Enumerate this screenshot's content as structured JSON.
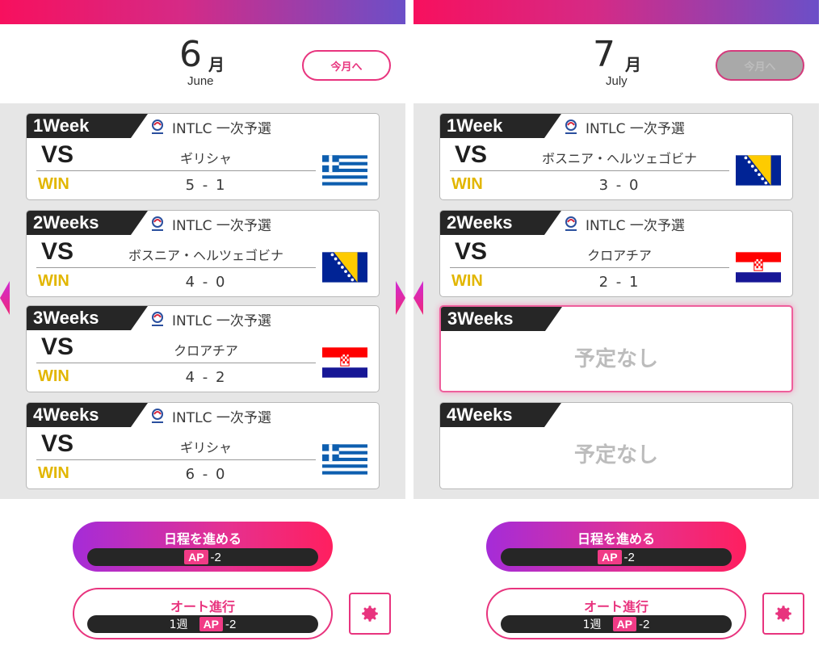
{
  "panels": [
    {
      "month": {
        "number": "6",
        "kanji": "月",
        "english": "June"
      },
      "this_month_button": "今月へ",
      "matches": [
        {
          "week": "1Week",
          "competition": "INTLC 一次予選",
          "vs": "VS",
          "opponent": "ギリシャ",
          "result": "WIN",
          "score": "5 - 1",
          "flag": "greece-flag"
        },
        {
          "week": "2Weeks",
          "competition": "INTLC 一次予選",
          "vs": "VS",
          "opponent": "ボスニア・ヘルツェゴビナ",
          "result": "WIN",
          "score": "4 - 0",
          "flag": "bosnia-flag"
        },
        {
          "week": "3Weeks",
          "competition": "INTLC 一次予選",
          "vs": "VS",
          "opponent": "クロアチア",
          "result": "WIN",
          "score": "4 - 2",
          "flag": "croatia-flag"
        },
        {
          "week": "4Weeks",
          "competition": "INTLC 一次予選",
          "vs": "VS",
          "opponent": "ギリシャ",
          "result": "WIN",
          "score": "6 - 0",
          "flag": "greece-flag"
        }
      ],
      "advance_button": {
        "label": "日程を進める",
        "ap_tag": "AP",
        "ap_value": "-2"
      },
      "auto_button": {
        "label": "オート進行",
        "weeks": "1週",
        "ap_tag": "AP",
        "ap_value": "-2"
      }
    },
    {
      "month": {
        "number": "7",
        "kanji": "月",
        "english": "July"
      },
      "this_month_button": "今月へ",
      "matches": [
        {
          "week": "1Week",
          "competition": "INTLC 一次予選",
          "vs": "VS",
          "opponent": "ボスニア・ヘルツェゴビナ",
          "result": "WIN",
          "score": "3 - 0",
          "flag": "bosnia-flag"
        },
        {
          "week": "2Weeks",
          "competition": "INTLC 一次予選",
          "vs": "VS",
          "opponent": "クロアチア",
          "result": "WIN",
          "score": "2 - 1",
          "flag": "croatia-flag"
        },
        {
          "week": "3Weeks",
          "empty_text": "予定なし"
        },
        {
          "week": "4Weeks",
          "empty_text": "予定なし"
        }
      ],
      "advance_button": {
        "label": "日程を進める",
        "ap_tag": "AP",
        "ap_value": "-2"
      },
      "auto_button": {
        "label": "オート進行",
        "weeks": "1週",
        "ap_tag": "AP",
        "ap_value": "-2"
      }
    }
  ],
  "colors": {
    "accent": "#e8347e",
    "win": "#e2b600",
    "tab": "#262626"
  }
}
